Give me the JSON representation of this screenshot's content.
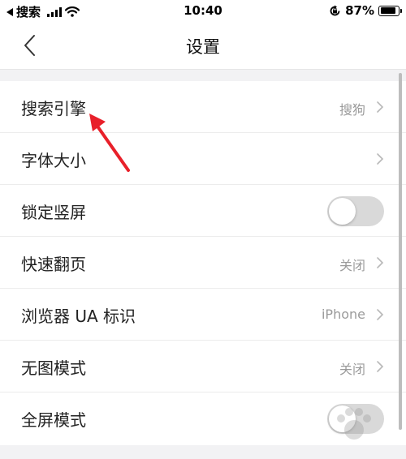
{
  "status_bar": {
    "back_app": "搜索",
    "time": "10:40",
    "battery": "87%",
    "battery_level": 0.87
  },
  "nav": {
    "title": "设置",
    "back_icon": "chevron-left-icon"
  },
  "settings": [
    {
      "label": "搜索引擎",
      "value": "搜狗",
      "control": "chevron"
    },
    {
      "label": "字体大小",
      "value": "",
      "control": "chevron"
    },
    {
      "label": "锁定竖屏",
      "control": "toggle",
      "on": false
    },
    {
      "label": "快速翻页",
      "value": "关闭",
      "control": "chevron"
    },
    {
      "label": "浏览器 UA 标识",
      "value": "iPhone",
      "control": "chevron"
    },
    {
      "label": "无图模式",
      "value": "关闭",
      "control": "chevron"
    },
    {
      "label": "全屏模式",
      "control": "toggle",
      "on": false
    }
  ],
  "colors": {
    "annotation_arrow": "#e8202a",
    "toggle_off": "#d9d9d9",
    "secondary_text": "#9a9a9a"
  }
}
